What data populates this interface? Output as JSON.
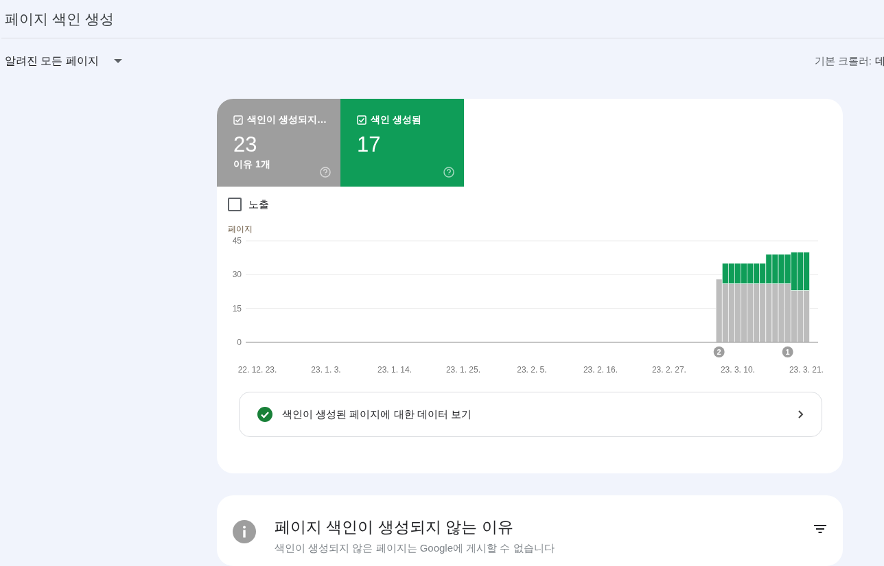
{
  "page_title": "페이지 색인 생성",
  "filter": {
    "label": "알려진 모든 페이지"
  },
  "crawler": {
    "label": "기본 크롤러:",
    "value": "데"
  },
  "summary_tiles": [
    {
      "label": "색인이 생성되지…",
      "count": "23",
      "note": "이유 1개",
      "color": "#9e9e9e",
      "checked": true
    },
    {
      "label": "색인 생성됨",
      "count": "17",
      "color": "#0f9d58",
      "checked": true
    }
  ],
  "impressions": {
    "label": "노출",
    "checked": false
  },
  "chart_data": {
    "type": "bar",
    "stacked": true,
    "ylabel": "페이지",
    "ylim": [
      0,
      45
    ],
    "yticks": [
      0,
      15,
      30,
      45
    ],
    "categories": [
      "22. 12. 23.",
      null,
      null,
      null,
      null,
      null,
      null,
      null,
      null,
      null,
      null,
      "23. 1. 3.",
      null,
      null,
      null,
      null,
      null,
      null,
      null,
      null,
      null,
      null,
      "23. 1. 14.",
      null,
      null,
      null,
      null,
      null,
      null,
      null,
      null,
      null,
      null,
      "23. 1. 25.",
      null,
      null,
      null,
      null,
      null,
      null,
      null,
      null,
      null,
      null,
      "23. 2. 5.",
      null,
      null,
      null,
      null,
      null,
      null,
      null,
      null,
      null,
      null,
      "23. 2. 16.",
      null,
      null,
      null,
      null,
      null,
      null,
      null,
      null,
      null,
      null,
      "23. 2. 27.",
      null,
      null,
      null,
      null,
      null,
      null,
      null,
      null,
      null,
      null,
      "23. 3. 10.",
      null,
      null,
      null,
      null,
      null,
      null,
      null,
      null,
      null,
      null,
      "23. 3. 21."
    ],
    "series": [
      {
        "color": "#bdbdbd",
        "values": [
          null,
          null,
          null,
          null,
          null,
          null,
          null,
          null,
          null,
          null,
          null,
          null,
          null,
          null,
          null,
          null,
          null,
          null,
          null,
          null,
          null,
          null,
          null,
          null,
          null,
          null,
          null,
          null,
          null,
          null,
          null,
          null,
          null,
          null,
          null,
          null,
          null,
          null,
          null,
          null,
          null,
          null,
          null,
          null,
          null,
          null,
          null,
          null,
          null,
          null,
          null,
          null,
          null,
          null,
          null,
          null,
          null,
          null,
          null,
          null,
          null,
          null,
          null,
          null,
          null,
          null,
          null,
          null,
          null,
          null,
          null,
          null,
          null,
          null,
          28,
          26,
          26,
          26,
          26,
          26,
          26,
          26,
          26,
          26,
          26,
          26,
          23,
          23,
          23
        ]
      },
      {
        "color": "#0f9d58",
        "values": [
          null,
          null,
          null,
          null,
          null,
          null,
          null,
          null,
          null,
          null,
          null,
          null,
          null,
          null,
          null,
          null,
          null,
          null,
          null,
          null,
          null,
          null,
          null,
          null,
          null,
          null,
          null,
          null,
          null,
          null,
          null,
          null,
          null,
          null,
          null,
          null,
          null,
          null,
          null,
          null,
          null,
          null,
          null,
          null,
          null,
          null,
          null,
          null,
          null,
          null,
          null,
          null,
          null,
          null,
          null,
          null,
          null,
          null,
          null,
          null,
          null,
          null,
          null,
          null,
          null,
          null,
          null,
          null,
          null,
          null,
          null,
          null,
          null,
          null,
          0,
          9,
          9,
          9,
          9,
          9,
          9,
          9,
          13,
          13,
          13,
          13,
          17,
          17,
          17
        ]
      }
    ],
    "annotations": [
      "2",
      "1"
    ]
  },
  "indexed_link": {
    "label": "색인이 생성된 페이지에 대한 데이터 보기"
  },
  "reasons": {
    "title": "페이지 색인이 생성되지 않는 이유",
    "subtitle": "색인이 생성되지 않은 페이지는 Google에 게시할 수 없습니다"
  }
}
